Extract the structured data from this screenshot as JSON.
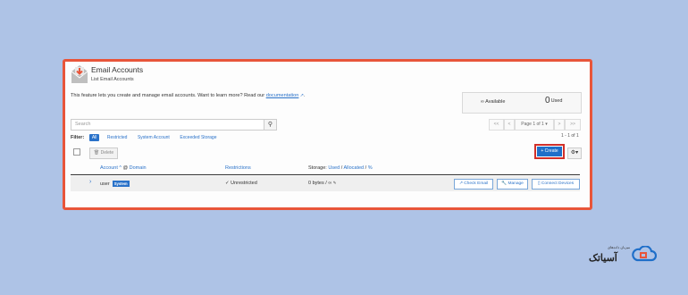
{
  "header": {
    "title": "Email Accounts",
    "subtitle": "List Email Accounts"
  },
  "intro": {
    "text": "This feature lets you create and manage email accounts. Want to learn more? Read our ",
    "link": "documentation",
    "suffix": "."
  },
  "stats": {
    "available_symbol": "∞",
    "available_label": "Available",
    "used_count": "0",
    "used_label": "Used"
  },
  "search": {
    "placeholder": "Search"
  },
  "pagination": {
    "first": "<<",
    "prev": "<",
    "page_label": "Page 1 of 1 ▾",
    "next": ">",
    "last": ">>",
    "range": "1 - 1 of 1"
  },
  "filter": {
    "label": "Filter:",
    "options": [
      "All",
      "Restricted",
      "System Account",
      "Exceeded Storage"
    ]
  },
  "toolbar": {
    "delete_label": "Delete",
    "create_label": "Create",
    "gear_label": "⚙▾"
  },
  "table": {
    "columns": {
      "account": "Account",
      "domain": "Domain",
      "restrictions": "Restrictions",
      "storage_prefix": "Storage:",
      "storage_used": "Used",
      "storage_allocated": "Allocated",
      "storage_pct": "%"
    },
    "rows": [
      {
        "account": "user",
        "badge": "System",
        "restrictions": "Unrestricted",
        "storage": "0 bytes / ∞",
        "actions": [
          "Check Email",
          "Manage",
          "Connect Devices"
        ]
      }
    ]
  },
  "brand": {
    "name": "آسیاتک",
    "tagline": "میزبان داده‌های",
    "accent": "#1f6fc9",
    "highlight": "#e8553a"
  }
}
